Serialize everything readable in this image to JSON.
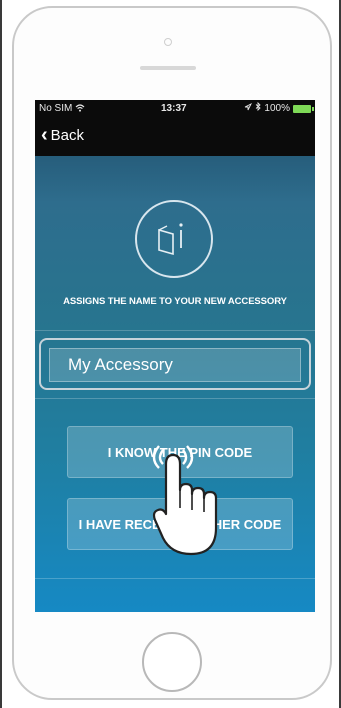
{
  "status_bar": {
    "carrier": "No SIM",
    "wifi_icon": "wifi-icon",
    "time": "13:37",
    "location_icon": "location-arrow-icon",
    "bluetooth_icon": "bluetooth-icon",
    "battery_percent": "100%",
    "battery_level": 1.0
  },
  "nav": {
    "back_label": "Back",
    "back_icon": "chevron-left-icon"
  },
  "logo": {
    "icon": "accessory-logo-icon"
  },
  "headline": "ASSIGNS THE NAME TO YOUR NEW ACCESSORY",
  "name_input": {
    "value": "My Accessory"
  },
  "buttons": {
    "pin_code": "I KNOW THE PIN CODE",
    "other_code": "I HAVE RECEIVED OTHER CODE"
  },
  "overlay": {
    "icon": "tap-hand-icon"
  },
  "colors": {
    "screen_top": "#1d4a66",
    "screen_bottom": "#1689c4",
    "bar": "#0b0b0b",
    "battery": "#7ed957"
  }
}
